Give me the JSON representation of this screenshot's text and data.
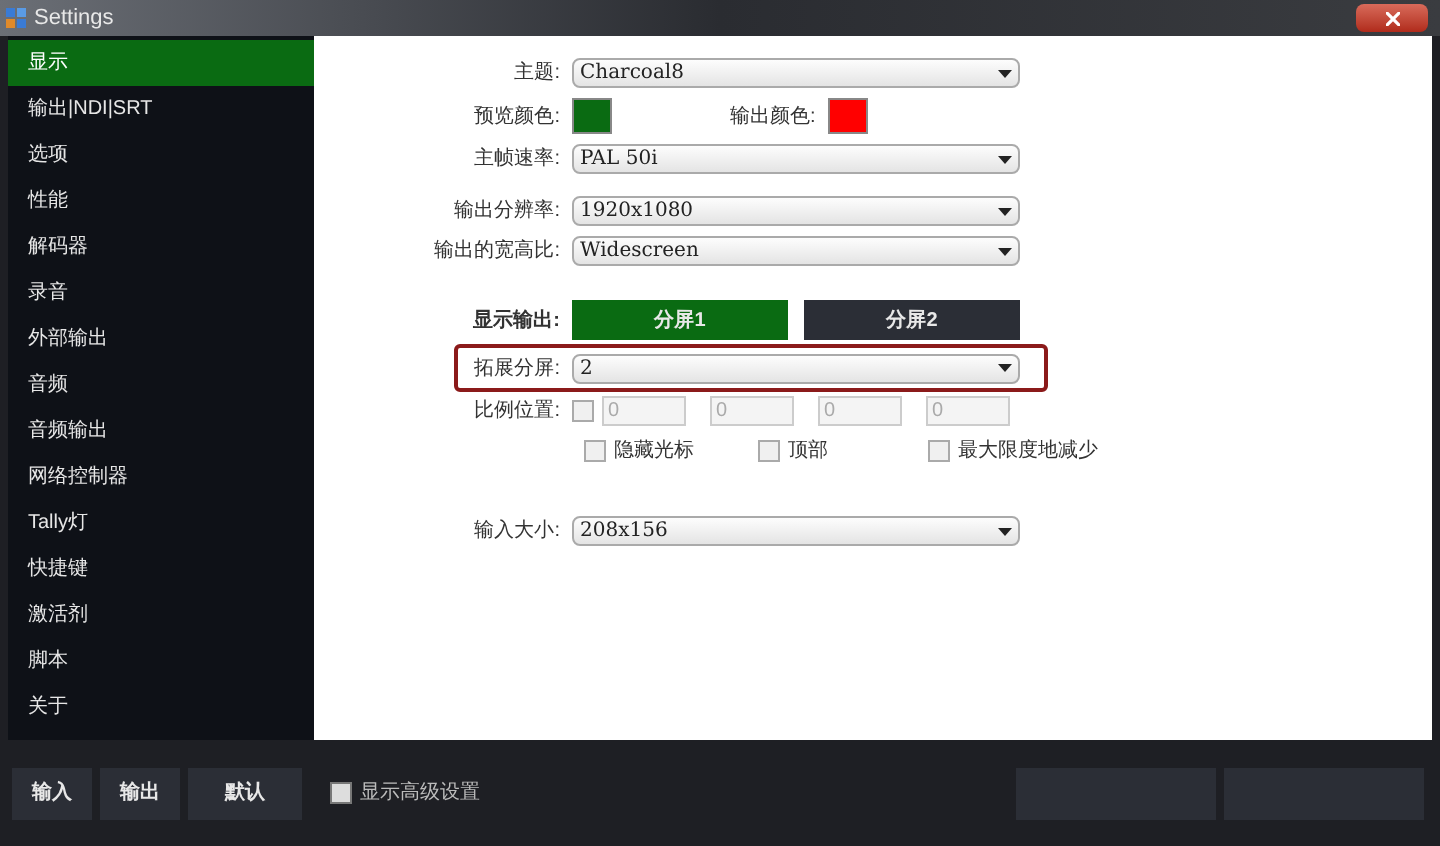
{
  "window": {
    "title": "Settings"
  },
  "sidebar": {
    "items": [
      {
        "label": "显示",
        "selected": true
      },
      {
        "label": "输出|NDI|SRT",
        "selected": false
      },
      {
        "label": "选项",
        "selected": false
      },
      {
        "label": "性能",
        "selected": false
      },
      {
        "label": "解码器",
        "selected": false
      },
      {
        "label": "录音",
        "selected": false
      },
      {
        "label": "外部输出",
        "selected": false
      },
      {
        "label": "音频",
        "selected": false
      },
      {
        "label": "音频输出",
        "selected": false
      },
      {
        "label": "网络控制器",
        "selected": false
      },
      {
        "label": "Tally灯",
        "selected": false
      },
      {
        "label": "快捷键",
        "selected": false
      },
      {
        "label": "激活剂",
        "selected": false
      },
      {
        "label": "脚本",
        "selected": false
      },
      {
        "label": "关于",
        "selected": false
      }
    ],
    "buttons": [
      "输入",
      "输出",
      "默认"
    ]
  },
  "form": {
    "theme": {
      "label": "主题:",
      "value": "Charcoal8"
    },
    "colors": [
      {
        "label": "预览颜色:",
        "color": "#0a6b12"
      },
      {
        "label": "输出颜色:",
        "color": "#ff0000"
      }
    ],
    "frame_rate": {
      "label": "主帧速率:",
      "value": "PAL 50i"
    },
    "resolution": {
      "label": "输出分辨率:",
      "value": "1920x1080"
    },
    "aspect": {
      "label": "输出的宽高比:",
      "value": "Widescreen"
    },
    "display_output": {
      "label": "显示输出:",
      "tabs": [
        {
          "label": "分屏1",
          "selected": true
        },
        {
          "label": "分屏2",
          "selected": false
        }
      ]
    },
    "extend_split": {
      "label": "拓展分屏:",
      "value": "2",
      "highlighted": true
    },
    "scale_position": {
      "label": "比例位置:",
      "checked": false,
      "values": [
        "0",
        "0",
        "0",
        "0"
      ]
    },
    "options": [
      {
        "label": "隐藏光标",
        "checked": false
      },
      {
        "label": "顶部",
        "checked": false
      },
      {
        "label": "最大限度地减少",
        "checked": false
      }
    ],
    "input_size": {
      "label": "输入大小:",
      "value": "208x156"
    }
  },
  "footer": {
    "advanced": {
      "label": "显示高级设置",
      "checked": false
    }
  }
}
